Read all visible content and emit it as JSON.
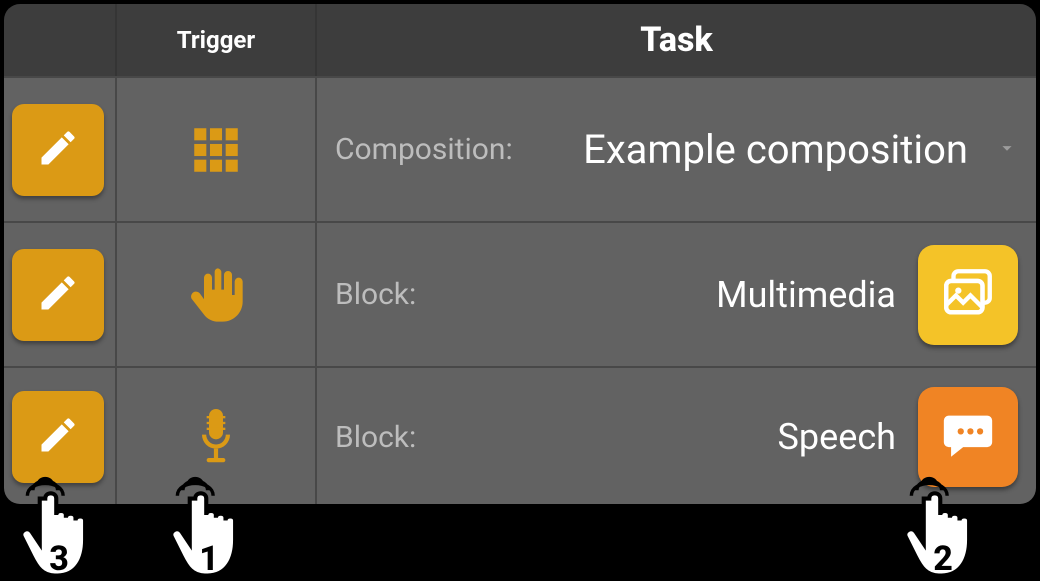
{
  "headers": {
    "col1": "",
    "col2": "Trigger",
    "col3": "Task"
  },
  "rows": [
    {
      "label": "Composition:",
      "value": "Example composition",
      "trigger": "grid",
      "block_color": null,
      "block_icon": null,
      "has_chevron": true
    },
    {
      "label": "Block:",
      "value": "Multimedia",
      "trigger": "hand",
      "block_color": "yellow",
      "block_icon": "gallery",
      "has_chevron": false
    },
    {
      "label": "Block:",
      "value": "Speech",
      "trigger": "mic",
      "block_color": "orange",
      "block_icon": "chat",
      "has_chevron": false
    }
  ],
  "pointers": {
    "p1": "3",
    "p2": "1",
    "p3": "2"
  },
  "colors": {
    "accent": "#db9a15",
    "yellow_btn": "#f4c328",
    "orange_btn": "#f08424",
    "header_bg": "#3d3d3d",
    "cell_bg": "#626262"
  }
}
